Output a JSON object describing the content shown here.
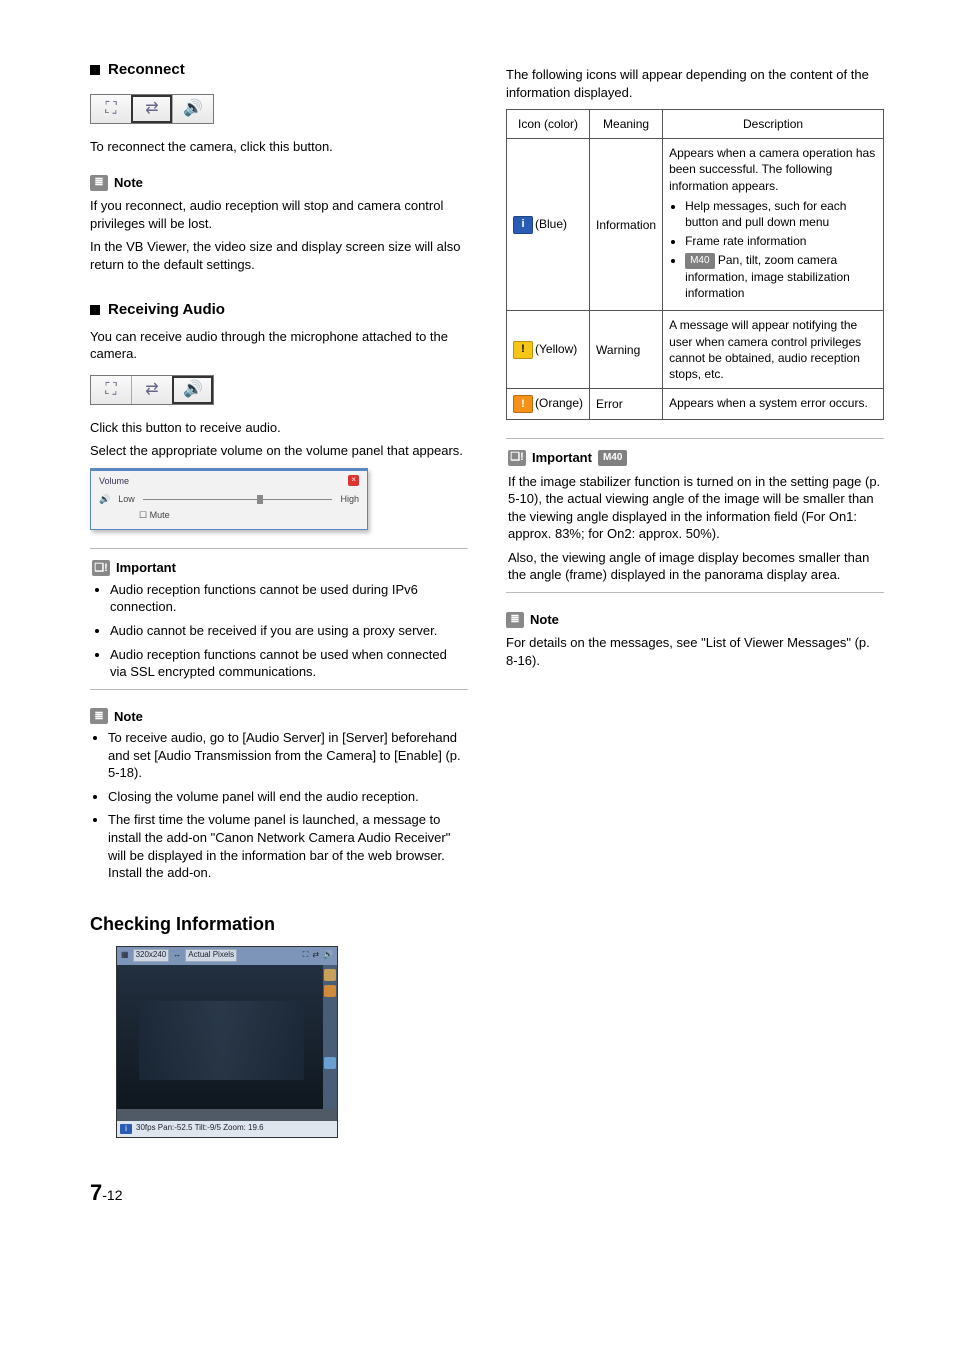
{
  "left": {
    "reconnect": {
      "heading": "Reconnect",
      "desc": "To reconnect the camera, click this button."
    },
    "note1": {
      "title": "Note",
      "p1": "If you reconnect, audio reception will stop and camera control privileges will be lost.",
      "p2": "In the VB Viewer, the video size and display screen size will also return to the default settings."
    },
    "audio": {
      "heading": "Receiving Audio",
      "p1": "You can receive audio through the microphone attached to the camera.",
      "p2": "Click this button to receive audio.",
      "p3": "Select the appropriate volume on the volume panel that appears."
    },
    "volume_panel": {
      "title": "Volume",
      "low": "Low",
      "high": "High",
      "mute": "Mute"
    },
    "important1": {
      "title": "Important",
      "items": [
        "Audio reception functions cannot be used during IPv6 connection.",
        "Audio cannot be received if you are using a proxy server.",
        "Audio reception functions cannot be used when connected via SSL encrypted communications."
      ]
    },
    "note2": {
      "title": "Note",
      "items": [
        "To receive audio, go to [Audio Server] in [Server] beforehand and set [Audio Transmission from the Camera] to [Enable] (p. 5-18).",
        "Closing the volume panel will end the audio reception.",
        "The first time the volume panel is launched, a message to install the add-on \"Canon Network Camera Audio Receiver\" will be displayed in the information bar of the web browser. Install the add-on."
      ]
    },
    "checking": {
      "heading": "Checking Information",
      "status_text": "30fps  Pan:-52.5  Tilt:-9/5  Zoom: 19.6",
      "top_size": "320x240",
      "top_mode": "Actual Pixels"
    }
  },
  "right": {
    "intro": "The following icons will appear depending on the content of the information displayed.",
    "table": {
      "headers": [
        "Icon (color)",
        "Meaning",
        "Description"
      ],
      "rows": [
        {
          "color_label": "(Blue)",
          "color_class": "sq-blue",
          "glyph": "i",
          "meaning": "Information",
          "desc_lead": "Appears when a camera operation has been successful. The following information appears.",
          "bullets": [
            "Help messages, such for each button and pull down menu",
            "Frame rate information"
          ],
          "badge_bullet_badge": "M40",
          "badge_bullet_text": " Pan, tilt, zoom camera information, image stabilization information"
        },
        {
          "color_label": "(Yellow)",
          "color_class": "sq-yellow",
          "glyph": "!",
          "meaning": "Warning",
          "desc_plain": "A message will appear notifying the user when camera control privileges cannot be obtained, audio reception stops, etc."
        },
        {
          "color_label": "(Orange)",
          "color_class": "sq-orange",
          "glyph": "!",
          "meaning": "Error",
          "desc_plain": "Appears when a system error occurs."
        }
      ]
    },
    "important2": {
      "title": "Important",
      "badge": "M40",
      "p1": "If the image stabilizer function is turned on in the setting page (p. 5-10), the actual viewing angle of the image will be smaller than the viewing angle displayed in the information field (For On1: approx. 83%; for On2: approx. 50%).",
      "p2": "Also, the viewing angle of image display becomes smaller than the angle (frame) displayed in the panorama display area."
    },
    "note3": {
      "title": "Note",
      "p1": "For details on the messages, see \"List of Viewer Messages\" (p. 8-16)."
    }
  },
  "page": {
    "chapter": "7",
    "num": "-12"
  }
}
